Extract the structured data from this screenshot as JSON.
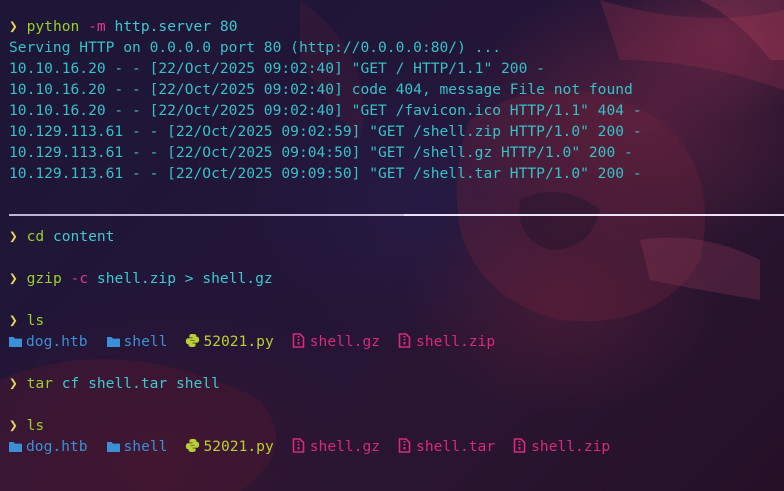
{
  "prompt_symbol": "❯",
  "lines": {
    "cmd1": {
      "cmd": "python",
      "flag": "-m",
      "args": "http.server 80"
    },
    "out1": "Serving HTTP on 0.0.0.0 port 80 (http://0.0.0.0:80/) ...",
    "out2": "10.10.16.20 - - [22/Oct/2025 09:02:40] \"GET / HTTP/1.1\" 200 -",
    "out3": "10.10.16.20 - - [22/Oct/2025 09:02:40] code 404, message File not found",
    "out4": "10.10.16.20 - - [22/Oct/2025 09:02:40] \"GET /favicon.ico HTTP/1.1\" 404 -",
    "out5": "10.129.113.61 - - [22/Oct/2025 09:02:59] \"GET /shell.zip HTTP/1.0\" 200 -",
    "out6": "10.129.113.61 - - [22/Oct/2025 09:04:50] \"GET /shell.gz HTTP/1.0\" 200 -",
    "out7": "10.129.113.61 - - [22/Oct/2025 09:09:50] \"GET /shell.tar HTTP/1.0\" 200 -",
    "cmd2": {
      "cmd": "cd",
      "args": "content"
    },
    "cmd3": {
      "cmd": "gzip",
      "flag": "-c",
      "args": "shell.zip > shell.gz"
    },
    "cmd4": {
      "cmd": "ls"
    },
    "cmd5": {
      "cmd": "tar",
      "args": "cf shell.tar shell"
    },
    "cmd6": {
      "cmd": "ls"
    }
  },
  "ls1": [
    {
      "name": "dog.htb",
      "kind": "folder-icon"
    },
    {
      "name": "shell",
      "kind": "folder-icon"
    },
    {
      "name": "52021.py",
      "kind": "python-icon"
    },
    {
      "name": "shell.gz",
      "kind": "archive-icon"
    },
    {
      "name": "shell.zip",
      "kind": "archive-icon"
    }
  ],
  "ls2": [
    {
      "name": "dog.htb",
      "kind": "folder-icon"
    },
    {
      "name": "shell",
      "kind": "folder-icon"
    },
    {
      "name": "52021.py",
      "kind": "python-icon"
    },
    {
      "name": "shell.gz",
      "kind": "archive-icon"
    },
    {
      "name": "shell.tar",
      "kind": "archive-icon"
    },
    {
      "name": "shell.zip",
      "kind": "archive-icon"
    }
  ],
  "colors": {
    "prompt": "#e5d45f",
    "command": "#9ad02a",
    "argument": "#3fc8d0",
    "flag": "#e5358f",
    "output": "#36c1c7",
    "directory": "#3a8fd6",
    "python_file": "#b8d033",
    "archive_file": "#d62a7a"
  }
}
